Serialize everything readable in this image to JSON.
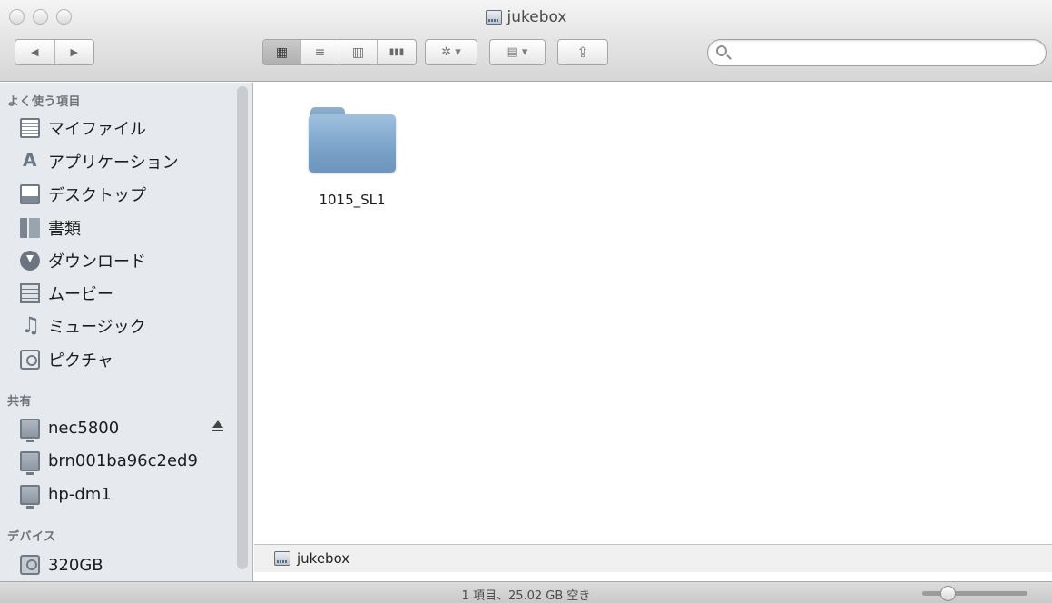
{
  "window": {
    "title": "jukebox"
  },
  "toolbar": {
    "back_label": "◀",
    "forward_label": "▶",
    "view_icon_label": "▦",
    "view_list_label": "≡",
    "view_column_label": "▥",
    "view_coverflow_label": "▮▮▮",
    "action_label": "✲ ▾",
    "arrange_label": "▤ ▾",
    "share_label": "⇪",
    "search_placeholder": ""
  },
  "sidebar": {
    "favorites_heading": "よく使う項目",
    "favorites": [
      {
        "label": "マイファイル",
        "icon": "all-my-files-icon"
      },
      {
        "label": "アプリケーション",
        "icon": "applications-icon"
      },
      {
        "label": "デスクトップ",
        "icon": "desktop-icon"
      },
      {
        "label": "書類",
        "icon": "documents-icon"
      },
      {
        "label": "ダウンロード",
        "icon": "downloads-icon"
      },
      {
        "label": "ムービー",
        "icon": "movies-icon"
      },
      {
        "label": "ミュージック",
        "icon": "music-icon"
      },
      {
        "label": "ピクチャ",
        "icon": "pictures-icon"
      }
    ],
    "shared_heading": "共有",
    "shared": [
      {
        "label": "nec5800",
        "icon": "network-computer-icon",
        "eject": true
      },
      {
        "label": "brn001ba96c2ed9",
        "icon": "network-computer-icon"
      },
      {
        "label": "hp-dm1",
        "icon": "network-computer-icon"
      }
    ],
    "devices_heading": "デバイス",
    "devices": [
      {
        "label": "320GB",
        "icon": "hard-drive-icon"
      }
    ]
  },
  "content": {
    "items": [
      {
        "name": "1015_SL1",
        "kind": "folder"
      }
    ]
  },
  "pathbar": {
    "label": "jukebox"
  },
  "statusbar": {
    "text": "1 項目、25.02 GB 空き",
    "icon_size_fraction": 0.2
  },
  "colors": {
    "sidebar_bg": "#e6eaef",
    "folder_blue": "#7aa2c8"
  }
}
